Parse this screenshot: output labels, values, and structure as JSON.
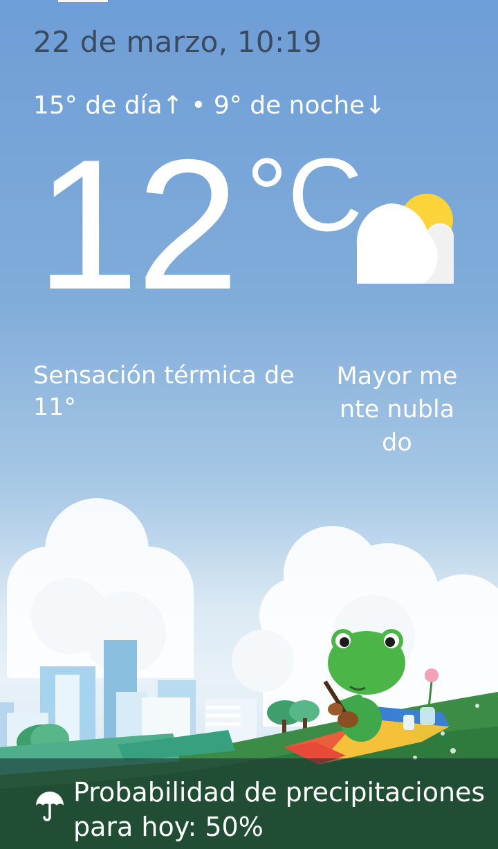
{
  "header": {
    "date_time": "22 de marzo, 10:19",
    "high_low": "15° de día↑ • 9° de noche↓"
  },
  "current": {
    "temperature": "12",
    "unit": "°C",
    "condition_icon": "mostly-cloudy-icon",
    "feels_like": "Sensación térmica de 11°",
    "condition": "Mayor mente nublado"
  },
  "scene": {
    "illustration": "frog-picnic-illustration"
  },
  "precipitation": {
    "icon": "umbrella-icon",
    "text": "Probabilidad de precipitaciones para hoy: 50%"
  },
  "colors": {
    "sky_top": "#6e9ed7",
    "date_text": "#3b4a5e",
    "sun": "#fdd33a",
    "frog": "#4cb548",
    "grass": "#2f7a3d"
  }
}
